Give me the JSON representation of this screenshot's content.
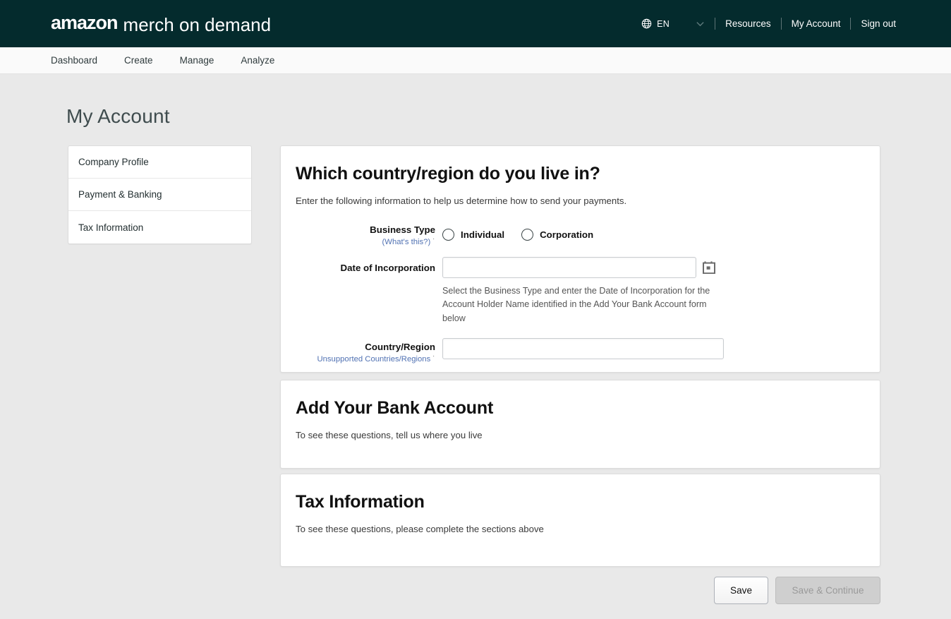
{
  "header": {
    "brand_amazon": "amazon",
    "brand_rest": "merch on demand",
    "globe_icon": "globe-icon",
    "language": "EN",
    "chevron_icon": "chevron-down-icon",
    "links": [
      {
        "label": "Resources"
      },
      {
        "label": "My Account"
      },
      {
        "label": "Sign out"
      }
    ]
  },
  "nav": {
    "items": [
      {
        "label": "Dashboard"
      },
      {
        "label": "Create"
      },
      {
        "label": "Manage"
      },
      {
        "label": "Analyze"
      }
    ]
  },
  "page": {
    "title": "My Account"
  },
  "sidebar": {
    "items": [
      {
        "label": "Company Profile"
      },
      {
        "label": "Payment & Banking"
      },
      {
        "label": "Tax Information"
      }
    ]
  },
  "country_card": {
    "title": "Which country/region do you live in?",
    "subtitle": "Enter the following information to help us determine how to send your payments.",
    "business_type": {
      "label": "Business Type",
      "whats_this": "(What's this?)",
      "dash": "˙",
      "options": [
        {
          "label": "Individual",
          "selected": false
        },
        {
          "label": "Corporation",
          "selected": false
        }
      ]
    },
    "date_of_incorporation": {
      "label": "Date of Incorporation",
      "value": "",
      "placeholder": "",
      "calendar_icon": "calendar-icon",
      "help": "Select the Business Type and enter the Date of Incorporation for the Account Holder Name identified in the Add Your Bank Account form below"
    },
    "country_region": {
      "label": "Country/Region",
      "unsupported_link": "Unsupported Countries/Regions",
      "dash": "˙",
      "value": "",
      "placeholder": ""
    }
  },
  "bank_card": {
    "title": "Add Your Bank Account",
    "subtitle": "To see these questions, tell us where you live"
  },
  "tax_card": {
    "title": "Tax Information",
    "subtitle": "To see these questions, please complete the sections above"
  },
  "footer": {
    "save_label": "Save",
    "save_continue_label": "Save & Continue"
  },
  "colors": {
    "header_bg": "#042B2D",
    "page_bg": "#e9e9e9",
    "nav_bg": "#fafafa",
    "link_blue": "#5172b3",
    "card_bg": "#ffffff"
  }
}
